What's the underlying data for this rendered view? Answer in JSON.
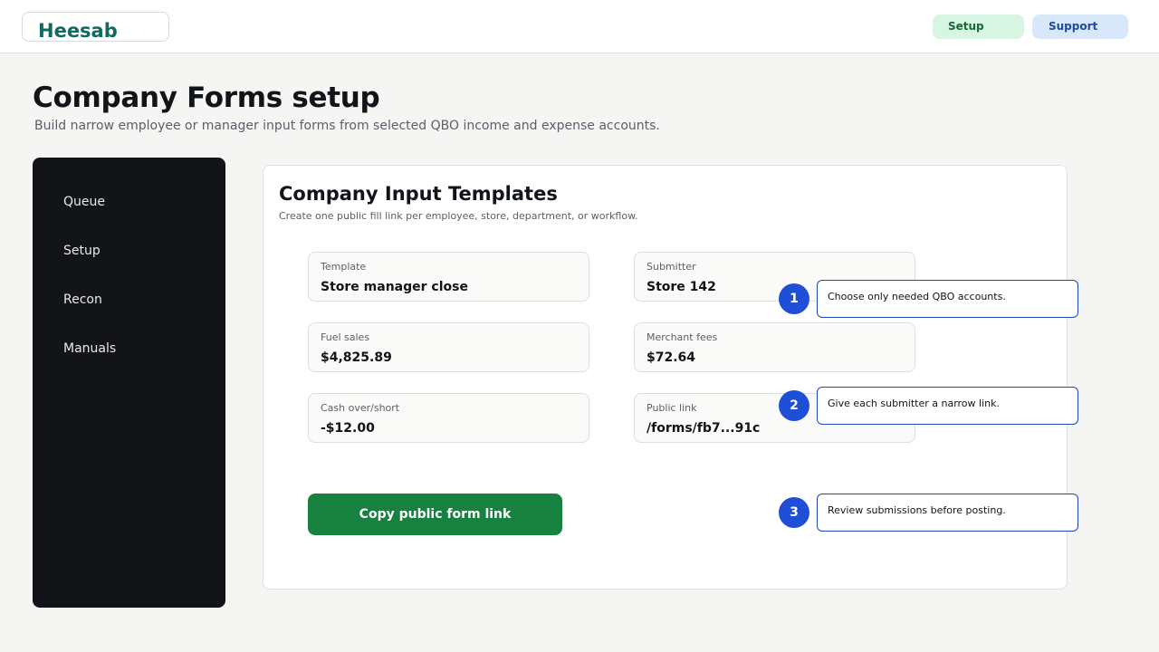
{
  "header": {
    "brand": "Heesab",
    "nav": {
      "setup_label": "Setup",
      "support_label": "Support"
    }
  },
  "page": {
    "title": "Company Forms setup",
    "subtitle": "Build narrow employee or manager input forms from selected QBO income and expense accounts."
  },
  "sidebar": {
    "items": [
      {
        "label": "Queue"
      },
      {
        "label": "Setup"
      },
      {
        "label": "Recon"
      },
      {
        "label": "Manuals"
      }
    ]
  },
  "templates": {
    "title": "Company Input Templates",
    "subtitle": "Create one public fill link per employee, store, department, or workflow.",
    "fields": {
      "template": {
        "label": "Template",
        "value": "Store manager close"
      },
      "submitter": {
        "label": "Submitter",
        "value": "Store 142"
      },
      "fuel_sales": {
        "label": "Fuel sales",
        "value": "$4,825.89"
      },
      "merchant_fees": {
        "label": "Merchant fees",
        "value": "$72.64"
      },
      "cash_over_short": {
        "label": "Cash over/short",
        "value": "-$12.00"
      },
      "public_link": {
        "label": "Public link",
        "value": "/forms/fb7...91c"
      }
    },
    "copy_button_label": "Copy public form link"
  },
  "steps": [
    {
      "number": "1",
      "text": "Choose only needed QBO accounts."
    },
    {
      "number": "2",
      "text": "Give each submitter a narrow link."
    },
    {
      "number": "3",
      "text": "Review submissions before posting."
    }
  ],
  "colors": {
    "brand": "#0f6b5f",
    "sidebar_bg": "#121418",
    "primary_button": "#17813f",
    "step_accent": "#1f4fd6"
  }
}
